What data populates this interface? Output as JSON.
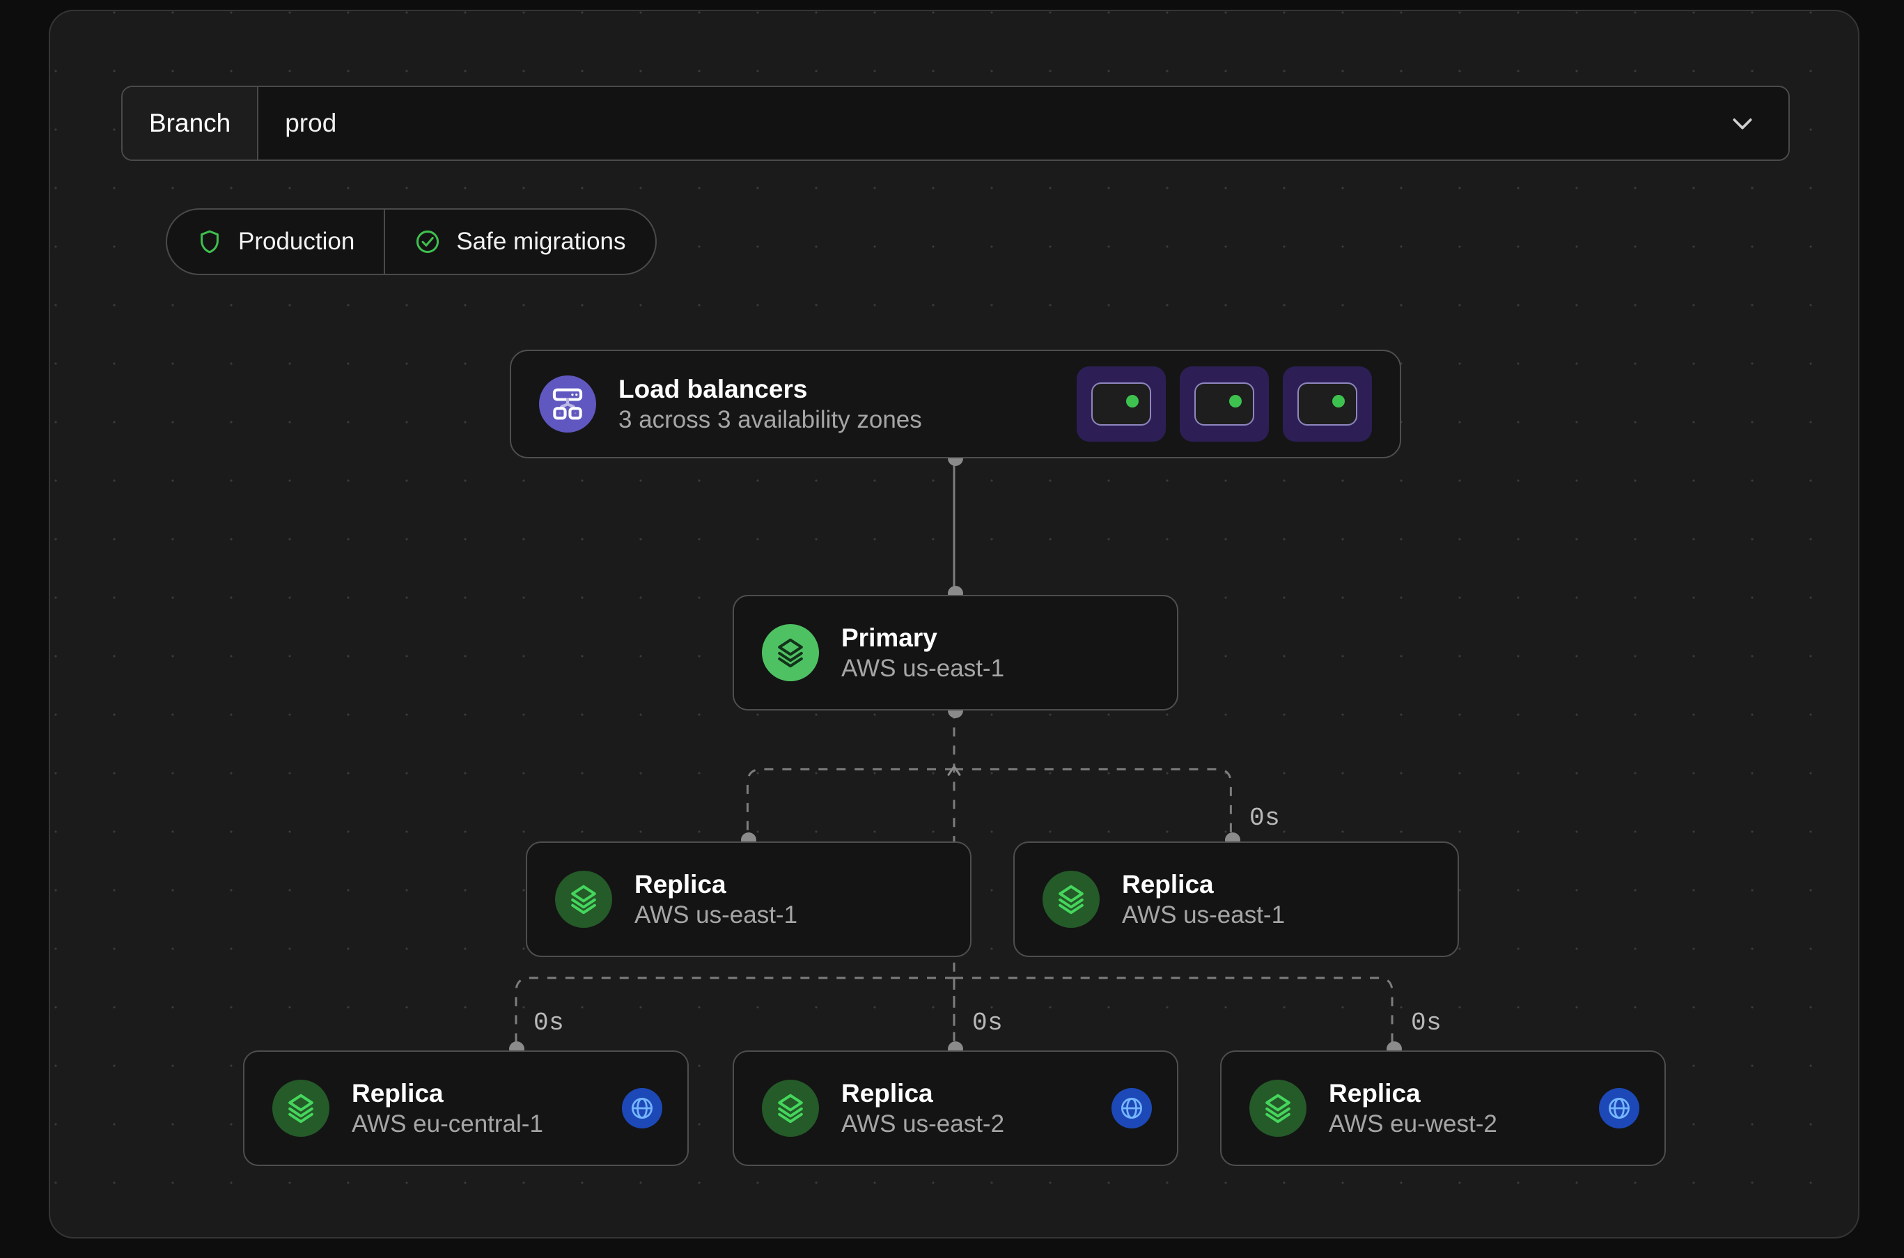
{
  "branch": {
    "label": "Branch",
    "value": "prod",
    "chevron_icon": "chevron-down-icon"
  },
  "badges": [
    {
      "label": "Production",
      "icon": "shield-icon",
      "color": "#3fbf4f"
    },
    {
      "label": "Safe migrations",
      "icon": "check-circle-icon",
      "color": "#3fbf4f"
    }
  ],
  "load_balancers": {
    "title": "Load balancers",
    "subtitle": "3 across 3 availability zones",
    "icon": "load-balancer-icon",
    "icon_bg": "#6058c0",
    "zones": [
      {
        "status_color": "#3ec24f"
      },
      {
        "status_color": "#3ec24f"
      },
      {
        "status_color": "#3ec24f"
      }
    ]
  },
  "nodes": {
    "primary": {
      "title": "Primary",
      "subtitle": "AWS us-east-1",
      "icon": "layers-icon",
      "icon_bg": "#4ec263"
    },
    "replicas": [
      {
        "title": "Replica",
        "subtitle": "AWS us-east-1",
        "icon": "layers-icon",
        "icon_bg": "#255a29",
        "globe": false
      },
      {
        "title": "Replica",
        "subtitle": "AWS us-east-1",
        "icon": "layers-icon",
        "icon_bg": "#255a29",
        "globe": false
      },
      {
        "title": "Replica",
        "subtitle": "AWS eu-central-1",
        "icon": "layers-icon",
        "icon_bg": "#255a29",
        "globe": true,
        "globe_icon": "globe-icon"
      },
      {
        "title": "Replica",
        "subtitle": "AWS us-east-2",
        "icon": "layers-icon",
        "icon_bg": "#255a29",
        "globe": true,
        "globe_icon": "globe-icon"
      },
      {
        "title": "Replica",
        "subtitle": "AWS eu-west-2",
        "icon": "layers-icon",
        "icon_bg": "#255a29",
        "globe": true,
        "globe_icon": "globe-icon"
      }
    ]
  },
  "edge_labels": [
    {
      "text": "0s"
    },
    {
      "text": "0s"
    },
    {
      "text": "0s"
    },
    {
      "text": "0s"
    }
  ],
  "colors": {
    "background": "#1b1b1b",
    "node_bg": "#141414",
    "node_border": "#4e4e4e",
    "edge": "#7d7d7d",
    "accent_green": "#3fbf4f",
    "accent_purple": "#6058c0",
    "accent_blue": "#1d49b8"
  }
}
